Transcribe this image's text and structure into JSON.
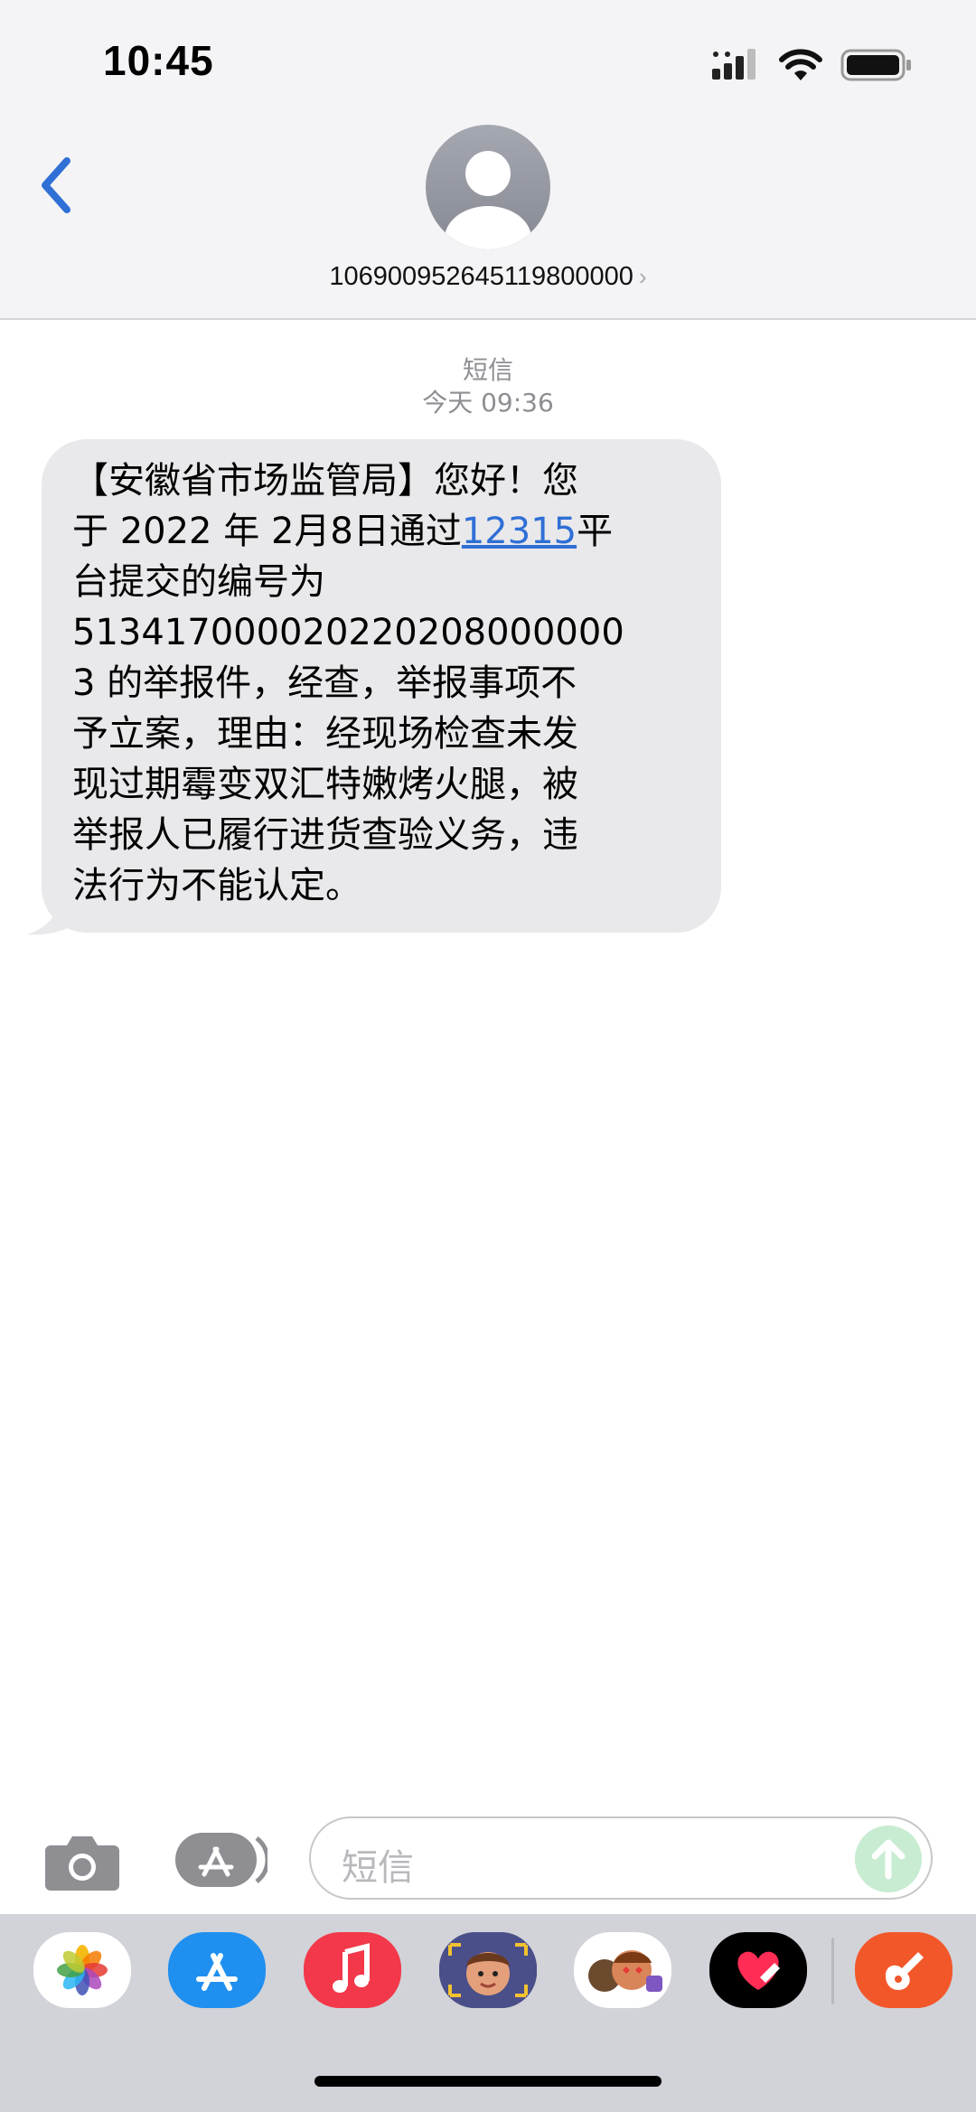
{
  "status_bar": {
    "time": "10:45"
  },
  "header": {
    "contact": "106900952645119800000",
    "chevron": "›"
  },
  "thread": {
    "service_label": "短信",
    "timestamp": "今天 09:36",
    "message": {
      "line1": "【安徽省市场监管局】您好！您",
      "line2_pre": "于 2022 年 2月8日通过",
      "line2_link": "12315",
      "line2_post": "平",
      "line3": "台提交的编号为",
      "line4": "513417000020220208000000",
      "line5": "3 的举报件，经查，举报事项不",
      "line6": "予立案，理由：经现场检查未发",
      "line7": "现过期霉变双汇特嫩烤火腿，被",
      "line8": "举报人已履行进货查验义务，违",
      "line9": "法行为不能认定。"
    }
  },
  "composer": {
    "placeholder": "短信"
  },
  "dock": {
    "apps": [
      "photos-icon",
      "app-store-icon",
      "music-icon",
      "memoji-icon",
      "animoji-icon",
      "digital-touch-icon",
      "garageband-icon"
    ]
  },
  "colors": {
    "link": "#2f6fd6",
    "back": "#2f6fd6",
    "bubble": "#e9e9eb",
    "send": "#c8ecd2"
  }
}
